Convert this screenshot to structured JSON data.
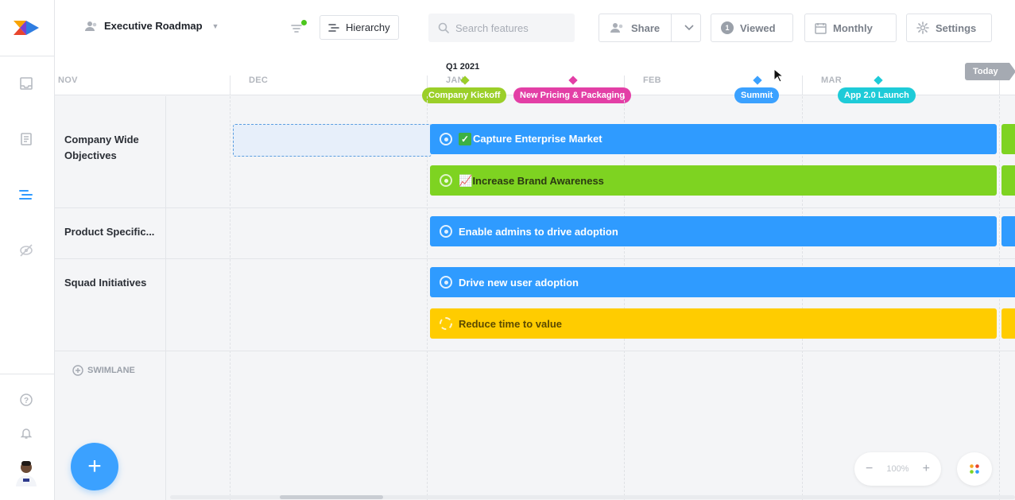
{
  "app": {
    "roadmap_name": "Executive Roadmap",
    "colors": {
      "accent": "#2f9bff",
      "green": "#7ed321",
      "yellow": "#ffcc00",
      "pink": "#e33fa6",
      "cyan": "#1ecbd8",
      "lime": "#9bcf29"
    }
  },
  "toolbar": {
    "hierarchy_label": "Hierarchy",
    "search_placeholder": "Search features",
    "share_label": "Share",
    "viewed_count": "1",
    "viewed_label": "Viewed",
    "monthly_label": "Monthly",
    "settings_label": "Settings"
  },
  "timeline": {
    "quarter_label": "Q1 2021",
    "months": [
      "NOV",
      "DEC",
      "JAN",
      "FEB",
      "MAR"
    ],
    "today_label": "Today",
    "milestones": [
      {
        "label": "Company Kickoff",
        "color": "#9bcf29"
      },
      {
        "label": "New Pricing & Packaging",
        "color": "#e33fa6"
      },
      {
        "label": "Summit",
        "color": "#3ba1ff"
      },
      {
        "label": "App 2.0 Launch",
        "color": "#1ecbd8"
      }
    ]
  },
  "swimlanes": [
    {
      "label": "Company Wide Objectives"
    },
    {
      "label": "Product Specific..."
    },
    {
      "label": "Squad Initiatives"
    }
  ],
  "add_swimlane_label": "SWIMLANE",
  "bars": [
    {
      "label": "Capture Enterprise Market",
      "color": "blue",
      "icon": "checkmark-emoji"
    },
    {
      "label": "Increase Brand Awareness",
      "color": "green",
      "icon": "chart-up-emoji"
    },
    {
      "label": "Enable admins to drive adoption",
      "color": "blue"
    },
    {
      "label": "Drive new user adoption",
      "color": "blue"
    },
    {
      "label": "Reduce time to value",
      "color": "yellow"
    }
  ],
  "zoom": {
    "value": "100%"
  }
}
